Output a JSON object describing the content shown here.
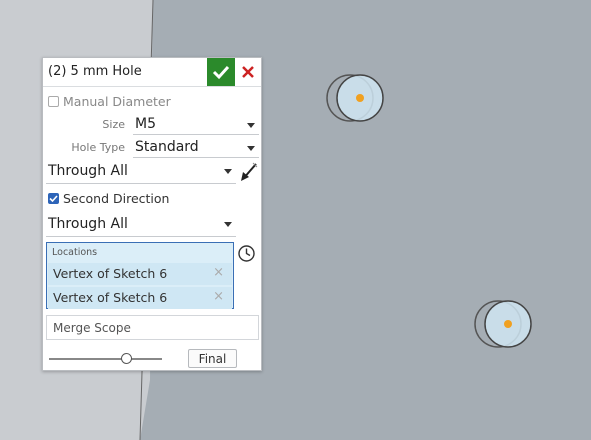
{
  "dialog": {
    "title": "(2) 5 mm Hole",
    "manual_diameter_label": "Manual Diameter",
    "size_label": "Size",
    "size_value": "M5",
    "hole_type_label": "Hole Type",
    "hole_type_value": "Standard",
    "end_condition_value": "Through All",
    "second_direction_label": "Second Direction",
    "second_direction_checked": true,
    "second_end_condition_value": "Through All",
    "locations_label": "Locations",
    "locations": [
      "Vertex of Sketch 6",
      "Vertex of Sketch 6"
    ],
    "merge_scope_label": "Merge Scope",
    "final_label": "Final",
    "rollback_slider_fraction": 0.8
  },
  "colors": {
    "accept": "#2b8a2b",
    "cancel": "#cc2222",
    "selection_fill": "#dbeef8",
    "selection_border": "#3a6fb5",
    "part_face": "#a4acb4",
    "background_plane": "#c9ccd0",
    "hole_point": "#f0a020"
  }
}
